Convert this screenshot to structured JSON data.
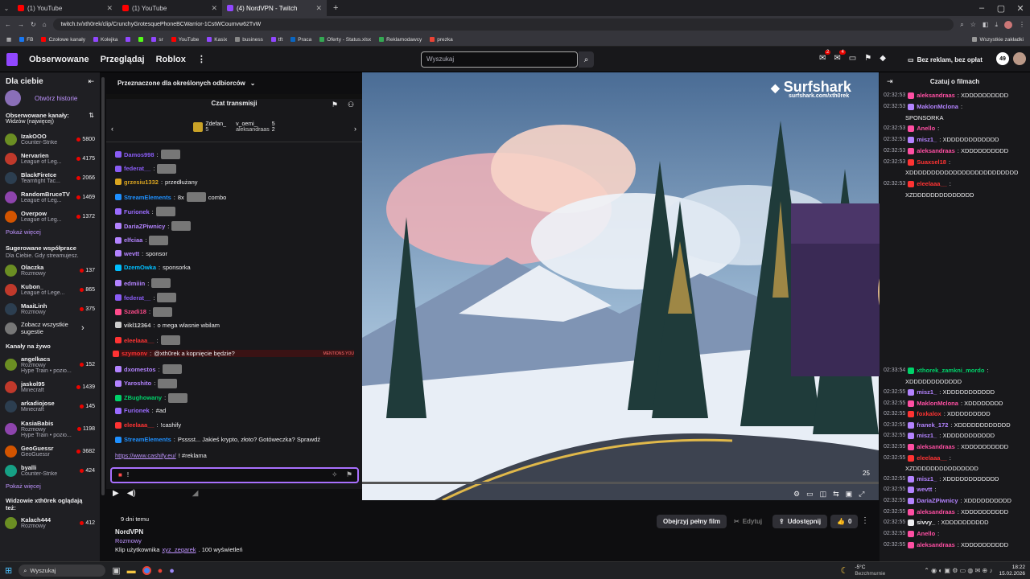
{
  "browser": {
    "tabs": [
      {
        "title": "(1) YouTube",
        "color": "#ff0000"
      },
      {
        "title": "(1) YouTube",
        "color": "#ff0000"
      },
      {
        "title": "(4) NordVPN - Twitch",
        "color": "#9147ff"
      }
    ],
    "url": "twitch.tv/xth0rek/clip/CrunchyGrotesquePhoneBCWarrior-1CstWCoumvw62TvW",
    "bookmarks": [
      "FB",
      "Czołowe kanały",
      "Kolejka",
      "sr",
      "YouTube",
      "Kasix",
      "business",
      "tft",
      "Praca",
      "Oferty - Status.xlsx",
      "Reklamodawcy",
      "prezka"
    ],
    "all_bookmarks": "Wszystkie zakładki"
  },
  "nav": {
    "links": [
      "Obserwowane",
      "Przeglądaj",
      "Roblox"
    ],
    "search_placeholder": "Wyszukaj",
    "notif_badge_1": "2",
    "notif_badge_2": "4",
    "adfree": "Bez reklam, bez opłat",
    "bits_badge": "49"
  },
  "sidebar": {
    "title": "Dla ciebie",
    "open_history": "Otwórz historie",
    "followed_label": "Obserwowane kanały:",
    "followed_sub": "Widzów (najwięcej)",
    "followed": [
      {
        "name": "IzakOOO",
        "game": "Counter-Strike",
        "viewers": "5800"
      },
      {
        "name": "Nervarien",
        "game": "League of Leg...",
        "viewers": "4175"
      },
      {
        "name": "BlackFireIce",
        "game": "Teamfight Tac...",
        "viewers": "2066"
      },
      {
        "name": "RandomBruceTV",
        "game": "League of Leg...",
        "viewers": "1469"
      },
      {
        "name": "Overpow",
        "game": "League of Leg...",
        "viewers": "1372"
      }
    ],
    "show_more": "Pokaż więcej",
    "suggested_label": "Sugerowane współprace",
    "suggested_sub": "Dla Ciebie. Gdy streamujesz.",
    "suggested": [
      {
        "name": "Olaczka",
        "game": "Rozmowy",
        "viewers": "137"
      },
      {
        "name": "Kubon_",
        "game": "League of Lege...",
        "viewers": "865"
      },
      {
        "name": "MaaiLinh",
        "game": "Rozmowy",
        "viewers": "375"
      }
    ],
    "see_all": "Zobacz wszystkie sugestie",
    "live_label": "Kanały na żywo",
    "live": [
      {
        "name": "angelkacs",
        "game": "Rozmowy",
        "viewers": "152",
        "extra": "Hype Train • pozio..."
      },
      {
        "name": "jaskol95",
        "game": "Minecraft",
        "viewers": "1439"
      },
      {
        "name": "arkadiojose",
        "game": "Minecraft",
        "viewers": "145"
      },
      {
        "name": "KasiaBabis",
        "game": "Rozmowy",
        "viewers": "1198",
        "extra": "Hype Train • pozio..."
      },
      {
        "name": "GeoGuessr",
        "game": "GeoGuessr",
        "viewers": "3682"
      },
      {
        "name": "byalli",
        "game": "Counter-Strike",
        "viewers": "424"
      }
    ],
    "show_more_2": "Pokaż więcej",
    "also_watch": "Widzowie xth0rek oglądają też:",
    "also": [
      {
        "name": "Kalach444",
        "game": "Rozmowy",
        "viewers": "412"
      }
    ]
  },
  "chat_overlay": {
    "header": "Przeznaczone dla określonych odbiorców",
    "title": "Czat transmisji",
    "gifts": [
      {
        "name": "Zdefan_",
        "count": "5"
      },
      {
        "name": "v_oemi_",
        "count": "5"
      },
      {
        "name": "aleksandraas",
        "count": "2"
      }
    ],
    "messages": [
      {
        "user": "Damos998",
        "text": "",
        "color": "#8a5cf5"
      },
      {
        "user": "federat__",
        "text": "",
        "color": "#8a5cf5"
      },
      {
        "user": "grzesiu1332",
        "text": "przedłużany",
        "color": "#daa520"
      },
      {
        "user": "StreamElements",
        "text": "8x",
        "extra": "combo",
        "color": "#1e90ff"
      },
      {
        "user": "Furionek",
        "text": "",
        "color": "#9a6bff"
      },
      {
        "user": "DariaZPiwnicy",
        "text": "",
        "color": "#b383ff"
      },
      {
        "user": "elfciaa",
        "text": "",
        "color": "#b383ff"
      },
      {
        "user": "wevtt",
        "text": "sponsor",
        "color": "#b383ff"
      },
      {
        "user": "DzemOwka",
        "text": "sponsorka",
        "color": "#00bfff"
      },
      {
        "user": "edmiiin",
        "text": "",
        "color": "#b383ff"
      },
      {
        "user": "federat__",
        "text": "",
        "color": "#8a5cf5"
      },
      {
        "user": "Szadi18",
        "text": "",
        "color": "#ff4b8b"
      },
      {
        "user": "vikl12364",
        "text": "o mega wlasnie wbilam",
        "color": "#cccccc"
      },
      {
        "user": "eleelaaa__",
        "text": "",
        "color": "#ff3333"
      },
      {
        "user": "szymonv",
        "text": "@xth0rek a kopnięcie będzie?",
        "color": "#ff3333",
        "mention": "MENTIONS YOU"
      },
      {
        "user": "dxomestos",
        "text": "",
        "color": "#b383ff"
      },
      {
        "user": "Yaroshito",
        "text": "",
        "color": "#b383ff"
      },
      {
        "user": "ZBughowany",
        "text": "",
        "color": "#00d26a"
      },
      {
        "user": "Furionek",
        "text": "#ad",
        "color": "#9a6bff"
      },
      {
        "user": "eleelaaa__",
        "text": "!cashify",
        "color": "#ff3333"
      },
      {
        "user": "StreamElements",
        "text": "Psssst... Jakieś krypto, złoto? Gotóweczka? Sprawdź",
        "color": "#1e90ff"
      }
    ],
    "link_line": "https://www.cashify.eu/",
    "link_suffix": "! #reklama",
    "input_value": "!"
  },
  "video": {
    "watermark_brand": "Surfshark",
    "watermark_url": "surfshark.com/xth0rek",
    "corner_count": "25",
    "progress": 0.0
  },
  "clip_info": {
    "age": "9 dni temu",
    "title": "NordVPN",
    "category": "Rozmowy",
    "clip_prefix": "Klip użytkownika",
    "clip_user": "xyz_zegarek",
    "views": ". 100 wyświetleń",
    "watch_full": "Obejrzyj pełny film",
    "edit": "Edytuj",
    "share": "Udostępnij",
    "likes": "0"
  },
  "right_chat": {
    "title": "Czatuj o filmach",
    "messages": [
      {
        "time": "02:32:53",
        "user": "aleksandraas",
        "text": ": XDDDDDDDDDD",
        "color": "#ff4fa3"
      },
      {
        "time": "02:32:53",
        "user": "MaklonMclona",
        "text": ":",
        "color": "#b383ff"
      },
      {
        "time": "",
        "user": "",
        "text": "SPONSORKA",
        "color": "#efeff1"
      },
      {
        "time": "02:32:53",
        "user": "Anello",
        "text": ":",
        "color": "#ff4fa3"
      },
      {
        "time": "02:32:53",
        "user": "misz1_",
        "text": ": XDDDDDDDDDDDD",
        "color": "#b383ff"
      },
      {
        "time": "02:32:53",
        "user": "aleksandraas",
        "text": ": XDDDDDDDDDD",
        "color": "#ff4fa3"
      },
      {
        "time": "02:32:53",
        "user": "Suaxsel18",
        "text": ":",
        "color": "#ff3333"
      },
      {
        "time": "",
        "user": "",
        "text": "XDDDDDDDDDDDDDDDDDDDDDDDDD",
        "color": "#efeff1"
      },
      {
        "time": "02:32:53",
        "user": "eleelaaa__",
        "text": ":",
        "color": "#ff3333"
      },
      {
        "time": "",
        "user": "",
        "text": "XZDDDDDDDDDDDDDD",
        "color": "#efeff1"
      },
      {
        "time": "02:33:54",
        "user": "xthorek_zamkni_mordo",
        "text": ":",
        "color": "#00d26a"
      },
      {
        "time": "",
        "user": "",
        "text": "XDDDDDDDDDDDD",
        "color": "#efeff1"
      },
      {
        "time": "02:32:55",
        "user": "misz1_",
        "text": ": XDDDDDDDDDDD",
        "color": "#b383ff"
      },
      {
        "time": "02:32:55",
        "user": "MaklonMclona",
        "text": ": XDDDDDDDD",
        "color": "#ff4fa3"
      },
      {
        "time": "02:32:55",
        "user": "foxkalox",
        "text": ": XDDDDDDDDD",
        "color": "#ff3333"
      },
      {
        "time": "02:32:55",
        "user": "franek_172",
        "text": ": XDDDDDDDDDDDD",
        "color": "#b383ff"
      },
      {
        "time": "02:32:55",
        "user": "misz1_",
        "text": ": XDDDDDDDDDDD",
        "color": "#b383ff"
      },
      {
        "time": "02:32:55",
        "user": "aleksandraas",
        "text": ": XDDDDDDDDDD",
        "color": "#ff4fa3"
      },
      {
        "time": "02:32:55",
        "user": "eleelaaa__",
        "text": ":",
        "color": "#ff3333"
      },
      {
        "time": "",
        "user": "",
        "text": "XZDDDDDDDDDDDDDDD",
        "color": "#efeff1"
      },
      {
        "time": "02:32:55",
        "user": "misz1_",
        "text": ": XDDDDDDDDDDDD",
        "color": "#b383ff"
      },
      {
        "time": "02:32:55",
        "user": "wevtt",
        "text": ":",
        "color": "#b383ff"
      },
      {
        "time": "02:32:55",
        "user": "DariaZPiwnicy",
        "text": ": XDDDDDDDDDD",
        "color": "#b383ff"
      },
      {
        "time": "02:32:55",
        "user": "aleksandraas",
        "text": ": XDDDDDDDDDD",
        "color": "#ff4fa3"
      },
      {
        "time": "02:32:55",
        "user": "sivvy_",
        "text": ": XDDDDDDDDDD",
        "color": "#efeff1"
      },
      {
        "time": "02:32:55",
        "user": "Anello",
        "text": ":",
        "color": "#ff4fa3"
      },
      {
        "time": "02:32:55",
        "user": "aleksandraas",
        "text": ": XDDDDDDDDDD",
        "color": "#ff4fa3"
      }
    ]
  },
  "taskbar": {
    "search": "Wyszukaj",
    "weather": "-5°C",
    "weather_sub": "Bezchmurnie",
    "time": "18:22",
    "date": "15.02.2026"
  }
}
